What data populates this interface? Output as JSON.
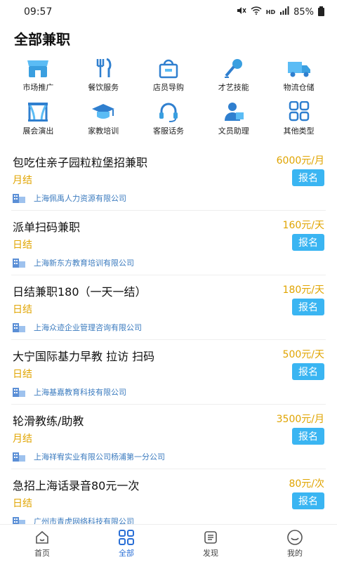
{
  "status": {
    "time": "09:57",
    "hd": "HD",
    "battery": "85%"
  },
  "page_title": "全部兼职",
  "categories": [
    {
      "label": "市场推广",
      "icon": "shop-icon"
    },
    {
      "label": "餐饮服务",
      "icon": "fork-knife-icon"
    },
    {
      "label": "店员导购",
      "icon": "shopping-bag-icon"
    },
    {
      "label": "才艺技能",
      "icon": "microphone-icon"
    },
    {
      "label": "物流仓储",
      "icon": "truck-icon"
    },
    {
      "label": "展会演出",
      "icon": "stage-icon"
    },
    {
      "label": "家教培训",
      "icon": "graduation-cap-icon"
    },
    {
      "label": "客服话务",
      "icon": "headset-icon"
    },
    {
      "label": "文员助理",
      "icon": "clerk-icon"
    },
    {
      "label": "其他类型",
      "icon": "grid-icon"
    }
  ],
  "jobs": [
    {
      "title": "包吃住亲子园粒粒堡招兼职",
      "salary": "6000元/月",
      "pay": "月结",
      "apply": "报名",
      "company": "上海佩禹人力资源有限公司"
    },
    {
      "title": "派单扫码兼职",
      "salary": "160元/天",
      "pay": "日结",
      "apply": "报名",
      "company": "上海新东方教育培训有限公司"
    },
    {
      "title": "日结兼职180（一天一结）",
      "salary": "180元/天",
      "pay": "日结",
      "apply": "报名",
      "company": "上海众迹企业管理咨询有限公司"
    },
    {
      "title": "大宁国际基力早教 拉访  扫码",
      "salary": "500元/天",
      "pay": "日结",
      "apply": "报名",
      "company": "上海基嘉教育科技有限公司"
    },
    {
      "title": "轮滑教练/助教",
      "salary": "3500元/月",
      "pay": "月结",
      "apply": "报名",
      "company": "上海祥宥实业有限公司杨浦第一分公司"
    },
    {
      "title": "急招上海话录音80元一次",
      "salary": "80元/次",
      "pay": "日结",
      "apply": "报名",
      "company": "广州市青虎网络科技有限公司"
    }
  ],
  "tabs": [
    {
      "label": "首页",
      "icon": "home-icon"
    },
    {
      "label": "全部",
      "icon": "grid-icon"
    },
    {
      "label": "发现",
      "icon": "discover-icon"
    },
    {
      "label": "我的",
      "icon": "profile-icon"
    }
  ],
  "colors": {
    "accent": "#3ab5f2",
    "salary": "#e0a400",
    "active_tab": "#2a6fd6",
    "company_link": "#3b7bbf"
  }
}
